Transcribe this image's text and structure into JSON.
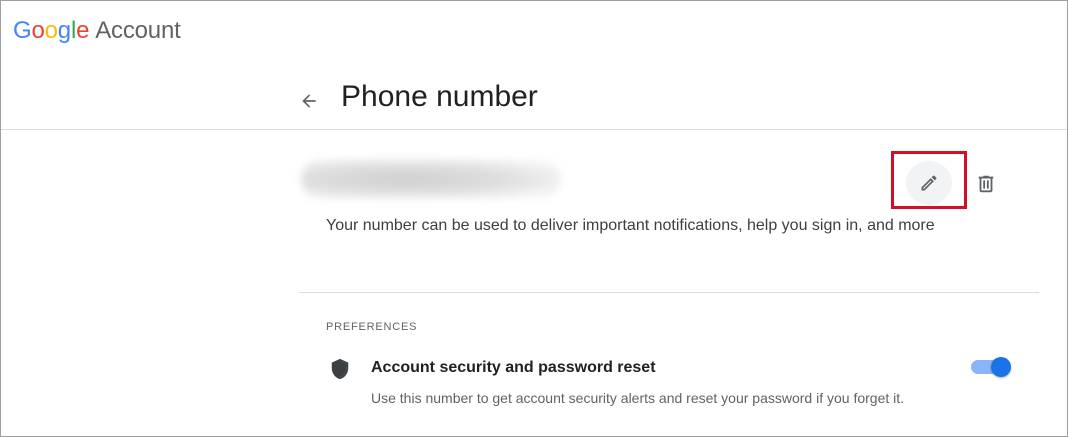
{
  "header": {
    "logo_letters": [
      {
        "char": "G",
        "color": "#4285f4"
      },
      {
        "char": "o",
        "color": "#ea4335"
      },
      {
        "char": "o",
        "color": "#fbbc05"
      },
      {
        "char": "g",
        "color": "#4285f4"
      },
      {
        "char": "l",
        "color": "#34a853"
      },
      {
        "char": "e",
        "color": "#ea4335"
      }
    ],
    "product_name": "Account"
  },
  "page": {
    "back_icon": "arrow-back-icon",
    "title": "Phone number"
  },
  "phone": {
    "actions": {
      "edit_icon": "pencil-icon",
      "delete_icon": "trash-icon",
      "highlight_color": "#d50f25"
    },
    "description": "Your number can be used to deliver important notifications, help you sign in, and more"
  },
  "preferences": {
    "heading": "PREFERENCES",
    "items": [
      {
        "icon": "shield-icon",
        "title": "Account security and password reset",
        "description": "Use this number to get account security alerts and reset your password if you forget it.",
        "enabled": true
      }
    ]
  },
  "colors": {
    "accent": "#1a73e8",
    "toggle_track": "#8ab4f8"
  }
}
